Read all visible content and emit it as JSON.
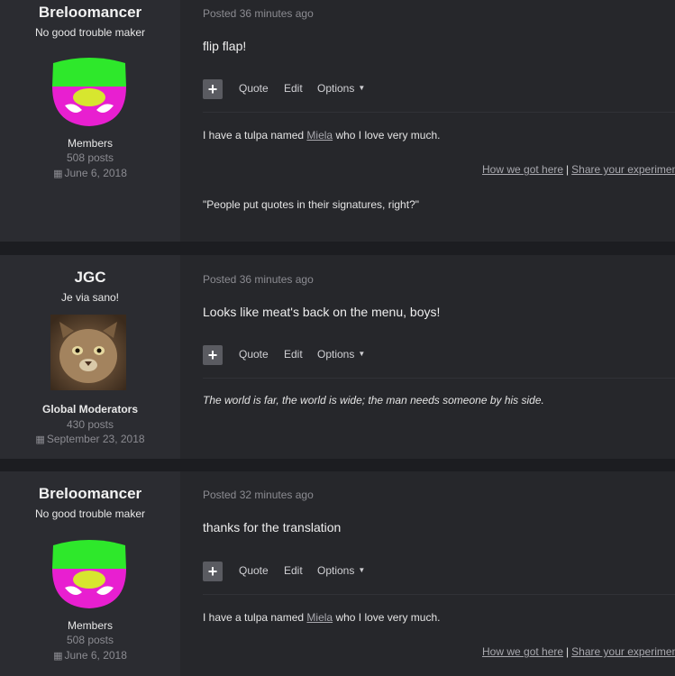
{
  "posts": [
    {
      "author": {
        "name": "Breloomancer",
        "title": "No good trouble maker",
        "avatar_icon": "breloom-mask-avatar",
        "group": "Members",
        "posts": "508 posts",
        "joined": "June 6, 2018"
      },
      "posted": "Posted 36 minutes ago",
      "message": "flip flap!",
      "actions": {
        "plus": "+",
        "quote": "Quote",
        "edit": "Edit",
        "options": "Options"
      },
      "signature": {
        "pre": "I have a tulpa named ",
        "link": "Miela",
        "post": " who I love very much.",
        "link1": "How we got here",
        "sep": "|",
        "link2": "Share your experiment",
        "quote": "\"People put quotes in their signatures, right?\""
      }
    },
    {
      "author": {
        "name": "JGC",
        "title": "Je via sano!",
        "avatar_icon": "cat-photo-avatar",
        "group": "Global Moderators",
        "posts": "430 posts",
        "joined": "September 23, 2018"
      },
      "posted": "Posted 36 minutes ago",
      "message": "Looks like meat's back on the menu, boys!",
      "actions": {
        "plus": "+",
        "quote": "Quote",
        "edit": "Edit",
        "options": "Options"
      },
      "signature": {
        "text": "The world is far, the world is wide; the man needs someone by his side."
      }
    },
    {
      "author": {
        "name": "Breloomancer",
        "title": "No good trouble maker",
        "avatar_icon": "breloom-mask-avatar",
        "group": "Members",
        "posts": "508 posts",
        "joined": "June 6, 2018"
      },
      "posted": "Posted 32 minutes ago",
      "message": "thanks for the translation",
      "actions": {
        "plus": "+",
        "quote": "Quote",
        "edit": "Edit",
        "options": "Options"
      },
      "signature": {
        "pre": "I have a tulpa named ",
        "link": "Miela",
        "post": " who I love very much.",
        "link1": "How we got here",
        "sep": "|",
        "link2": "Share your experiment"
      }
    }
  ],
  "colors": {
    "page_bg": "#1c1d21",
    "post_bg": "#26272b",
    "author_bg": "#2b2c31",
    "avatar_green": "#2ee82b",
    "avatar_magenta": "#e81fd0",
    "avatar_yellow": "#d7e62f"
  }
}
